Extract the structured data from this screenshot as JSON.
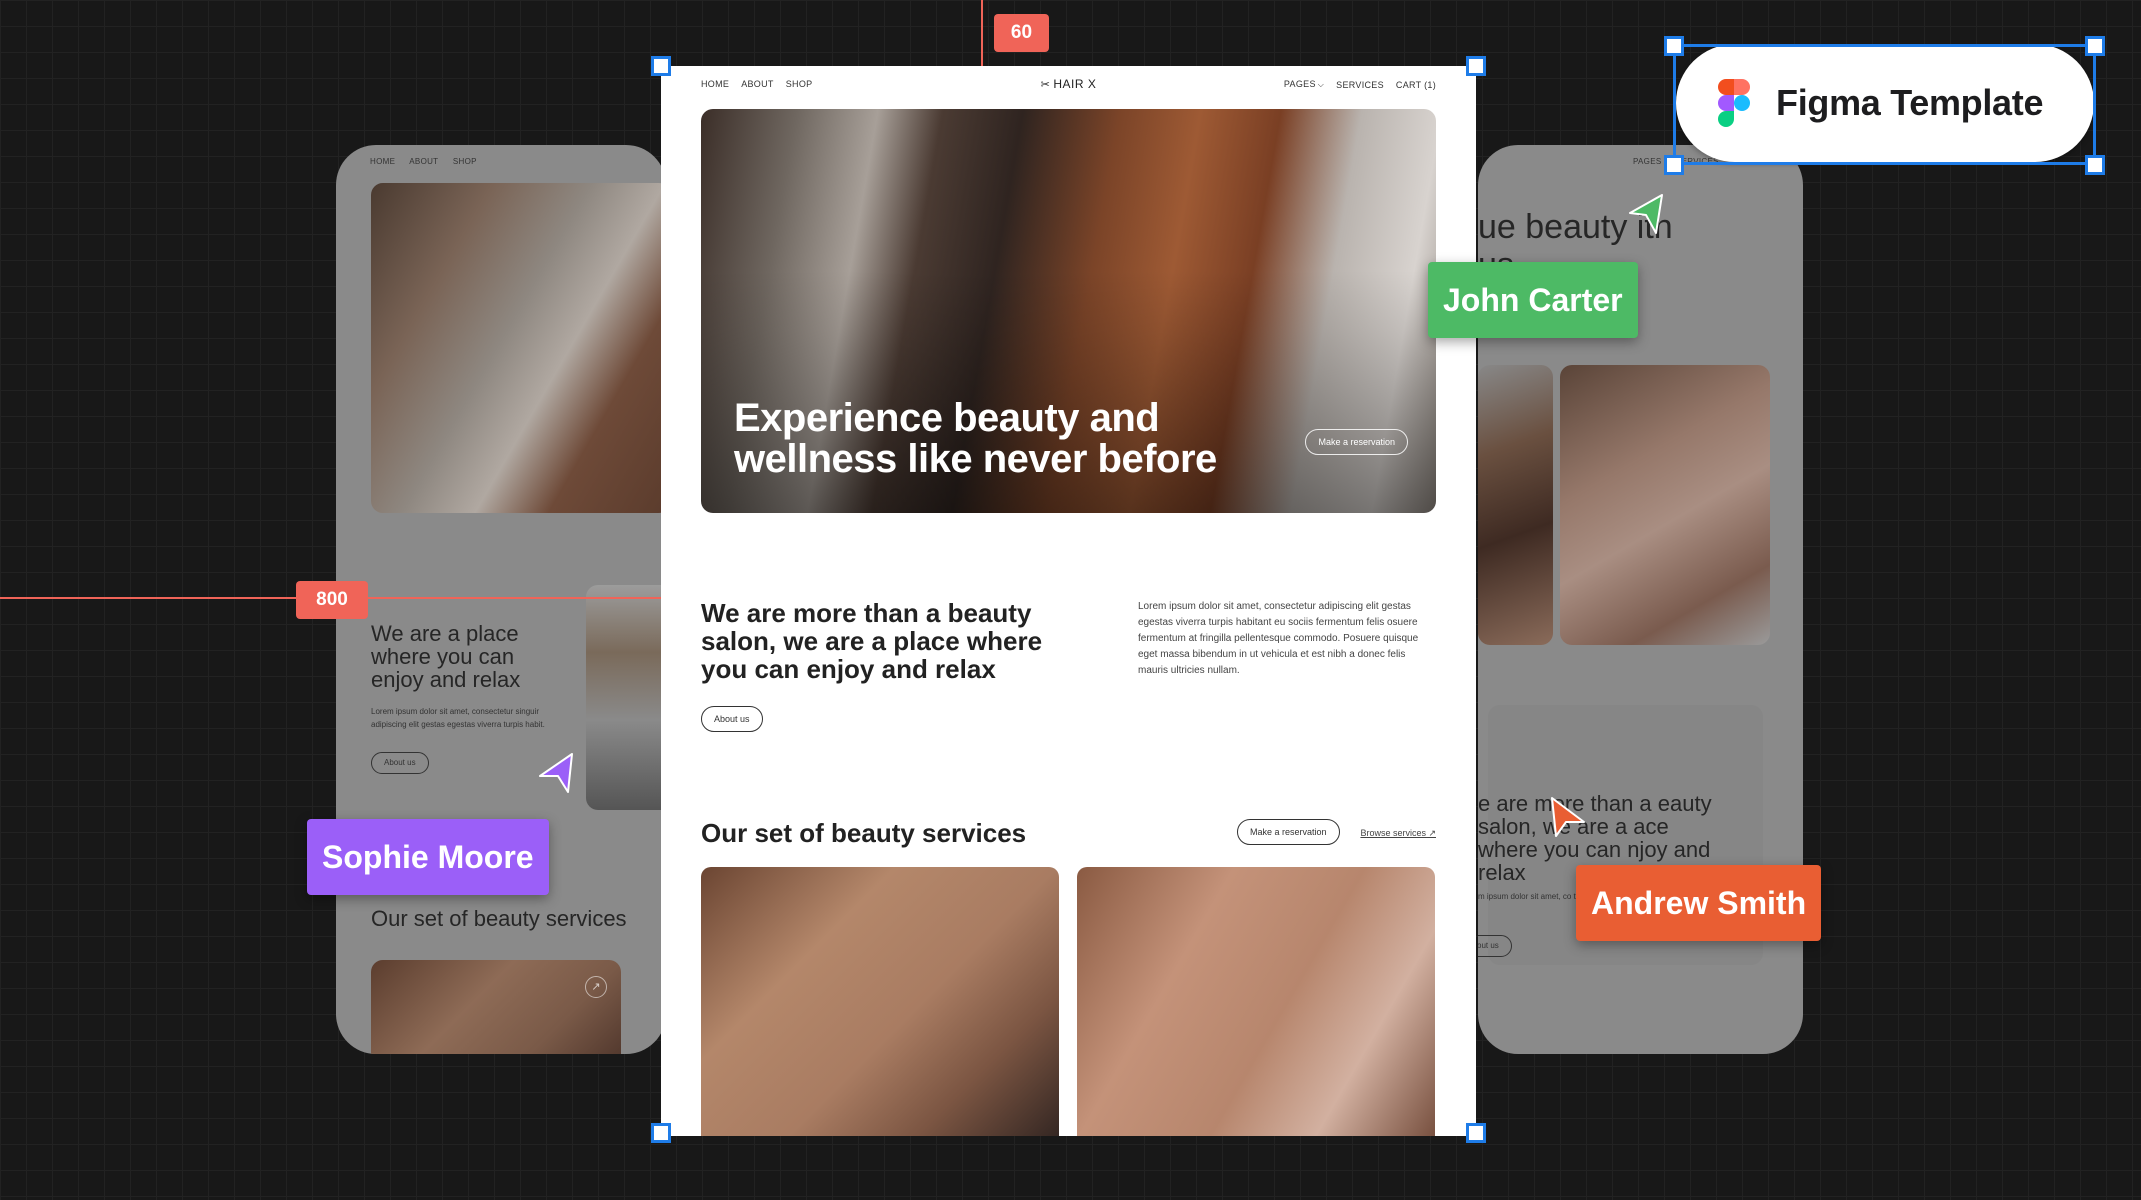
{
  "canvas": {
    "measurements": {
      "top_spacing": "60",
      "left_offset": "800"
    },
    "badge": {
      "label": "Figma Template",
      "icon": "figma-logo-icon"
    },
    "collaborators": [
      {
        "name": "John Carter",
        "color": "#4dba65"
      },
      {
        "name": "Sophie Moore",
        "color": "#9b5ff8"
      },
      {
        "name": "Andrew Smith",
        "color": "#e95e33"
      }
    ],
    "accent_color": "#1e7ce8",
    "guide_color": "#f06458"
  },
  "site": {
    "logo": {
      "icon": "scissors-icon",
      "text": "HAIR X"
    },
    "nav_left": [
      "HOME",
      "ABOUT",
      "SHOP"
    ],
    "nav_right": {
      "pages": "PAGES",
      "services": "SERVICES",
      "cart": "CART (1)"
    },
    "hero": {
      "title": "Experience beauty and wellness like never before",
      "cta": "Make a reservation"
    },
    "about": {
      "heading": "We are more than a beauty salon, we are a place where you can enjoy and relax",
      "paragraph": "Lorem ipsum dolor sit amet, consectetur adipiscing elit gestas egestas viverra turpis habitant eu sociis fermentum felis osuere fermentum at fringilla pellentesque commodo. Posuere quisque eget massa bibendum in ut vehicula et est nibh a donec felis mauris ultricies nullam.",
      "button": "About us"
    },
    "services": {
      "title": "Our set of beauty services",
      "reserve_button": "Make a reservation",
      "browse_link": "Browse services ↗"
    }
  },
  "left_preview": {
    "nav": [
      "HOME",
      "ABOUT",
      "SHOP"
    ],
    "heading": "We are a place where you can enjoy and relax",
    "paragraph": "Lorem ipsum dolor sit amet, consectetur singuir adipiscing elit gestas egestas viverra turpis habit.",
    "button": "About us",
    "services_title": "Our set of beauty services"
  },
  "right_preview": {
    "nav": [
      "PAGES",
      "SERVICES"
    ],
    "heading": "ue beauty ith us",
    "heading2": "e are more than a eauty salon, we are a ace where you can njoy and relax",
    "paragraph": "m ipsum dolor sit amet, co tas viverra turpis habitan",
    "button": "out us"
  }
}
